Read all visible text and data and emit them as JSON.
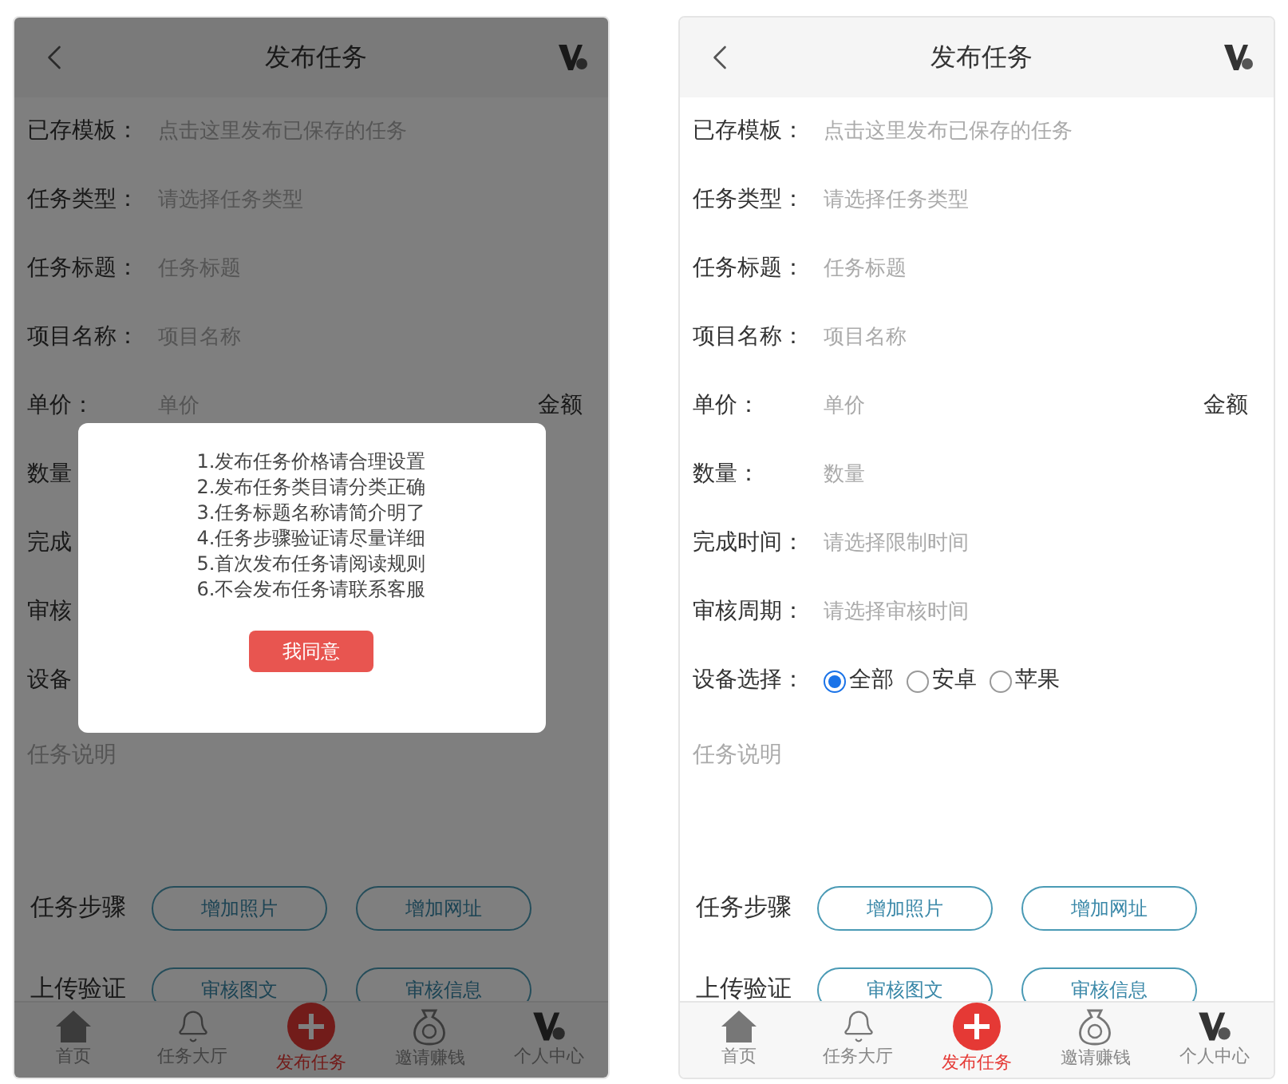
{
  "phones": [
    {
      "title": "发布任务",
      "overlay": true,
      "rows": [
        {
          "kind": "input",
          "label": "已存模板：",
          "placeholder": "点击这里发布已保存的任务"
        },
        {
          "kind": "input",
          "label": "任务类型：",
          "placeholder": "请选择任务类型"
        },
        {
          "kind": "input",
          "label": "任务标题：",
          "placeholder": "任务标题"
        },
        {
          "kind": "input",
          "label": "项目名称：",
          "placeholder": "项目名称"
        },
        {
          "kind": "input",
          "label": "单价：",
          "placeholder": "单价",
          "suffix": "金额"
        },
        {
          "kind": "input",
          "label": "数量"
        },
        {
          "kind": "input",
          "label": "完成"
        },
        {
          "kind": "input",
          "label": "审核"
        },
        {
          "kind": "input",
          "label": "设备"
        }
      ],
      "description_placeholder": "任务说明",
      "steps": [
        {
          "label": "任务步骤",
          "buttons": [
            "增加照片",
            "增加网址"
          ]
        },
        {
          "label": "上传验证",
          "buttons": [
            "审核图文",
            "审核信息"
          ]
        }
      ],
      "dialog": {
        "lines": [
          "1.发布任务价格请合理设置",
          "2.发布任务类目请分类正确",
          "3.任务标题名称请简介明了",
          "4.任务步骤验证请尽量详细",
          "5.首次发布任务请阅读规则",
          "6.不会发布任务请联系客服"
        ],
        "button": "我同意"
      },
      "nav": [
        {
          "kind": "home",
          "label": "首页",
          "selected": false
        },
        {
          "kind": "bell",
          "label": "任务大厅",
          "selected": false
        },
        {
          "kind": "plus",
          "label": "发布任务",
          "selected": true
        },
        {
          "kind": "bag",
          "label": "邀请赚钱",
          "selected": false
        },
        {
          "kind": "vip",
          "label": "个人中心",
          "selected": false
        }
      ]
    },
    {
      "title": "发布任务",
      "overlay": false,
      "rows": [
        {
          "kind": "input",
          "label": "已存模板：",
          "placeholder": "点击这里发布已保存的任务"
        },
        {
          "kind": "input",
          "label": "任务类型：",
          "placeholder": "请选择任务类型"
        },
        {
          "kind": "input",
          "label": "任务标题：",
          "placeholder": "任务标题"
        },
        {
          "kind": "input",
          "label": "项目名称：",
          "placeholder": "项目名称"
        },
        {
          "kind": "input",
          "label": "单价：",
          "placeholder": "单价",
          "suffix": "金额"
        },
        {
          "kind": "input",
          "label": "数量：",
          "placeholder": "数量"
        },
        {
          "kind": "input",
          "label": "完成时间：",
          "placeholder": "请选择限制时间"
        },
        {
          "kind": "input",
          "label": "审核周期：",
          "placeholder": "请选择审核时间"
        },
        {
          "kind": "radio",
          "label": "设备选择：",
          "options": [
            {
              "label": "全部",
              "selected": true
            },
            {
              "label": "安卓",
              "selected": false
            },
            {
              "label": "苹果",
              "selected": false
            }
          ]
        }
      ],
      "description_placeholder": "任务说明",
      "steps": [
        {
          "label": "任务步骤",
          "buttons": [
            "增加照片",
            "增加网址"
          ]
        },
        {
          "label": "上传验证",
          "buttons": [
            "审核图文",
            "审核信息"
          ]
        }
      ],
      "nav": [
        {
          "kind": "home",
          "label": "首页",
          "selected": false
        },
        {
          "kind": "bell",
          "label": "任务大厅",
          "selected": false
        },
        {
          "kind": "plus",
          "label": "发布任务",
          "selected": true
        },
        {
          "kind": "bag",
          "label": "邀请赚钱",
          "selected": false
        },
        {
          "kind": "vip",
          "label": "个人中心",
          "selected": false
        }
      ]
    }
  ]
}
